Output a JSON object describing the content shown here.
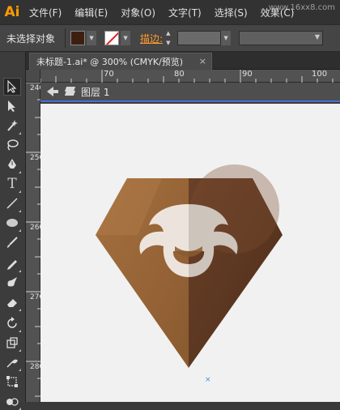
{
  "app": {
    "logo": "Ai"
  },
  "menubar": {
    "items": [
      "文件(F)",
      "编辑(E)",
      "对象(O)",
      "文字(T)",
      "选择(S)",
      "效果(C)"
    ],
    "watermark": "www.16xx8.com"
  },
  "control_bar": {
    "selection_status": "未选择对象",
    "fill_color": "#3d1f12",
    "stroke_label": "描边:"
  },
  "document_tab": {
    "title": "未标题-1.ai* @ 300% (CMYK/预览)",
    "close": "×"
  },
  "rulers": {
    "horizontal": [
      "70",
      "80",
      "90",
      "100"
    ],
    "vertical": [
      "240",
      "250",
      "260",
      "270",
      "280"
    ]
  },
  "layer_bar": {
    "label": "图层 1"
  },
  "tools": [
    "selection-tool",
    "direct-selection-tool",
    "magic-wand-tool",
    "lasso-tool",
    "pen-tool",
    "type-tool",
    "line-segment-tool",
    "ellipse-tool",
    "paintbrush-tool",
    "pencil-tool",
    "blob-brush-tool",
    "eraser-tool",
    "rotate-tool",
    "scale-tool",
    "warp-tool",
    "free-transform-tool",
    "shape-builder-tool"
  ],
  "artwork": {
    "colors": {
      "light_brown": "#a06a3a",
      "dark_brown": "#5a3520",
      "mark": "#ece4dc"
    }
  }
}
